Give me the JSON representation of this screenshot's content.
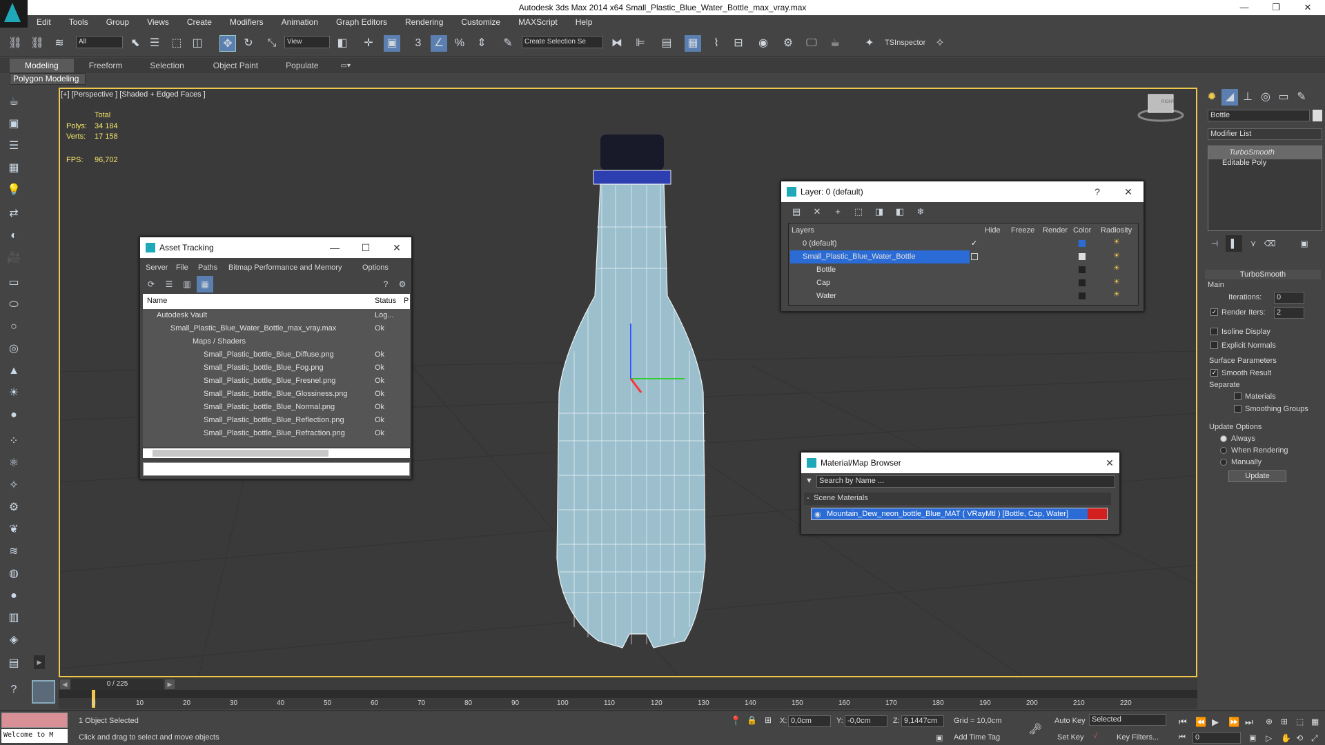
{
  "window": {
    "title": "Autodesk 3ds Max  2014 x64     Small_Plastic_Blue_Water_Bottle_max_vray.max",
    "min": "—",
    "restore": "❐",
    "close": "✕"
  },
  "menu": [
    "Edit",
    "Tools",
    "Group",
    "Views",
    "Create",
    "Modifiers",
    "Animation",
    "Graph Editors",
    "Rendering",
    "Customize",
    "MAXScript",
    "Help"
  ],
  "toolbar": {
    "selection_filter": "All",
    "reference_coord": "View",
    "named_selection": "Create Selection Se",
    "plugin_label": "TSInspector"
  },
  "ribbon": {
    "tabs": [
      "Modeling",
      "Freeform",
      "Selection",
      "Object Paint",
      "Populate"
    ],
    "active_tab": "Modeling",
    "sub_panel": "Polygon Modeling"
  },
  "viewport": {
    "label": "[+] [Perspective ] [Shaded + Edged Faces ]",
    "stats": {
      "total_label": "Total",
      "polys_label": "Polys:",
      "polys": "34 184",
      "verts_label": "Verts:",
      "verts": "17 158",
      "fps_label": "FPS:",
      "fps": "96,702"
    },
    "viewcube_label": "RIGHT"
  },
  "asset_tracking": {
    "title": "Asset Tracking",
    "menu": [
      "Server",
      "File",
      "Paths",
      "Bitmap Performance and Memory",
      "Options"
    ],
    "col_name": "Name",
    "col_status": "Status",
    "col_p": "P",
    "rows": [
      {
        "name": "Autodesk Vault",
        "status": "Log...",
        "indent": 0
      },
      {
        "name": "Small_Plastic_Blue_Water_Bottle_max_vray.max",
        "status": "Ok",
        "indent": 1
      },
      {
        "name": "Maps / Shaders",
        "status": "",
        "indent": 2
      },
      {
        "name": "Small_Plastic_bottle_Blue_Diffuse.png",
        "status": "Ok",
        "indent": 3
      },
      {
        "name": "Small_Plastic_bottle_Blue_Fog.png",
        "status": "Ok",
        "indent": 3
      },
      {
        "name": "Small_Plastic_bottle_Blue_Fresnel.png",
        "status": "Ok",
        "indent": 3
      },
      {
        "name": "Small_Plastic_bottle_Blue_Glossiness.png",
        "status": "Ok",
        "indent": 3
      },
      {
        "name": "Small_Plastic_bottle_Blue_Normal.png",
        "status": "Ok",
        "indent": 3
      },
      {
        "name": "Small_Plastic_bottle_Blue_Reflection.png",
        "status": "Ok",
        "indent": 3
      },
      {
        "name": "Small_Plastic_bottle_Blue_Refraction.png",
        "status": "Ok",
        "indent": 3
      }
    ]
  },
  "layer_window": {
    "title": "Layer: 0 (default)",
    "help": "?",
    "cols": [
      "Layers",
      "Hide",
      "Freeze",
      "Render",
      "Color",
      "Radiosity"
    ],
    "rows": [
      {
        "name": "0 (default)",
        "indent": 0,
        "selected": false,
        "color": "#2a6bd6"
      },
      {
        "name": "Small_Plastic_Blue_Water_Bottle",
        "indent": 0,
        "selected": true,
        "color": "#dddddd"
      },
      {
        "name": "Bottle",
        "indent": 1,
        "selected": false,
        "color": "#222222"
      },
      {
        "name": "Cap",
        "indent": 1,
        "selected": false,
        "color": "#222222"
      },
      {
        "name": "Water",
        "indent": 1,
        "selected": false,
        "color": "#222222"
      }
    ]
  },
  "material_browser": {
    "title": "Material/Map Browser",
    "search_placeholder": "Search by Name ...",
    "group": "Scene Materials",
    "item": "Mountain_Dew_neon_bottle_Blue_MAT  ( VRayMtl ) [Bottle, Cap, Water]"
  },
  "command_panel": {
    "object_name": "Bottle",
    "modifier_list": "Modifier List",
    "stack": [
      "TurboSmooth",
      "Editable Poly"
    ],
    "rollout_title": "TurboSmooth",
    "main_label": "Main",
    "iterations_label": "Iterations:",
    "iterations": "0",
    "render_iters_label": "Render Iters:",
    "render_iters": "2",
    "isoline": "Isoline Display",
    "explicit_normals": "Explicit Normals",
    "surface_params": "Surface Parameters",
    "smooth_result": "Smooth Result",
    "separate": "Separate",
    "materials": "Materials",
    "smoothing_groups": "Smoothing Groups",
    "update_options": "Update Options",
    "always": "Always",
    "when_rendering": "When Rendering",
    "manually": "Manually",
    "update_button": "Update"
  },
  "timeline": {
    "frame": "0 / 225",
    "ticks": [
      "0",
      "10",
      "20",
      "30",
      "40",
      "50",
      "60",
      "70",
      "80",
      "90",
      "100",
      "110",
      "120",
      "130",
      "140",
      "150",
      "160",
      "170",
      "180",
      "190",
      "200",
      "210",
      "220"
    ]
  },
  "status": {
    "maxscript": "Welcome to M",
    "selected": "1 Object Selected",
    "prompt": "Click and drag to select and move objects",
    "x_label": "X:",
    "x": "0,0cm",
    "y_label": "Y:",
    "y": "-0,0cm",
    "z_label": "Z:",
    "z": "9,1447cm",
    "grid": "Grid = 10,0cm",
    "add_time_tag": "Add Time Tag",
    "auto_key": "Auto Key",
    "set_key": "Set Key",
    "key_mode": "Selected",
    "key_filters": "Key Filters...",
    "frame_field": "0"
  }
}
